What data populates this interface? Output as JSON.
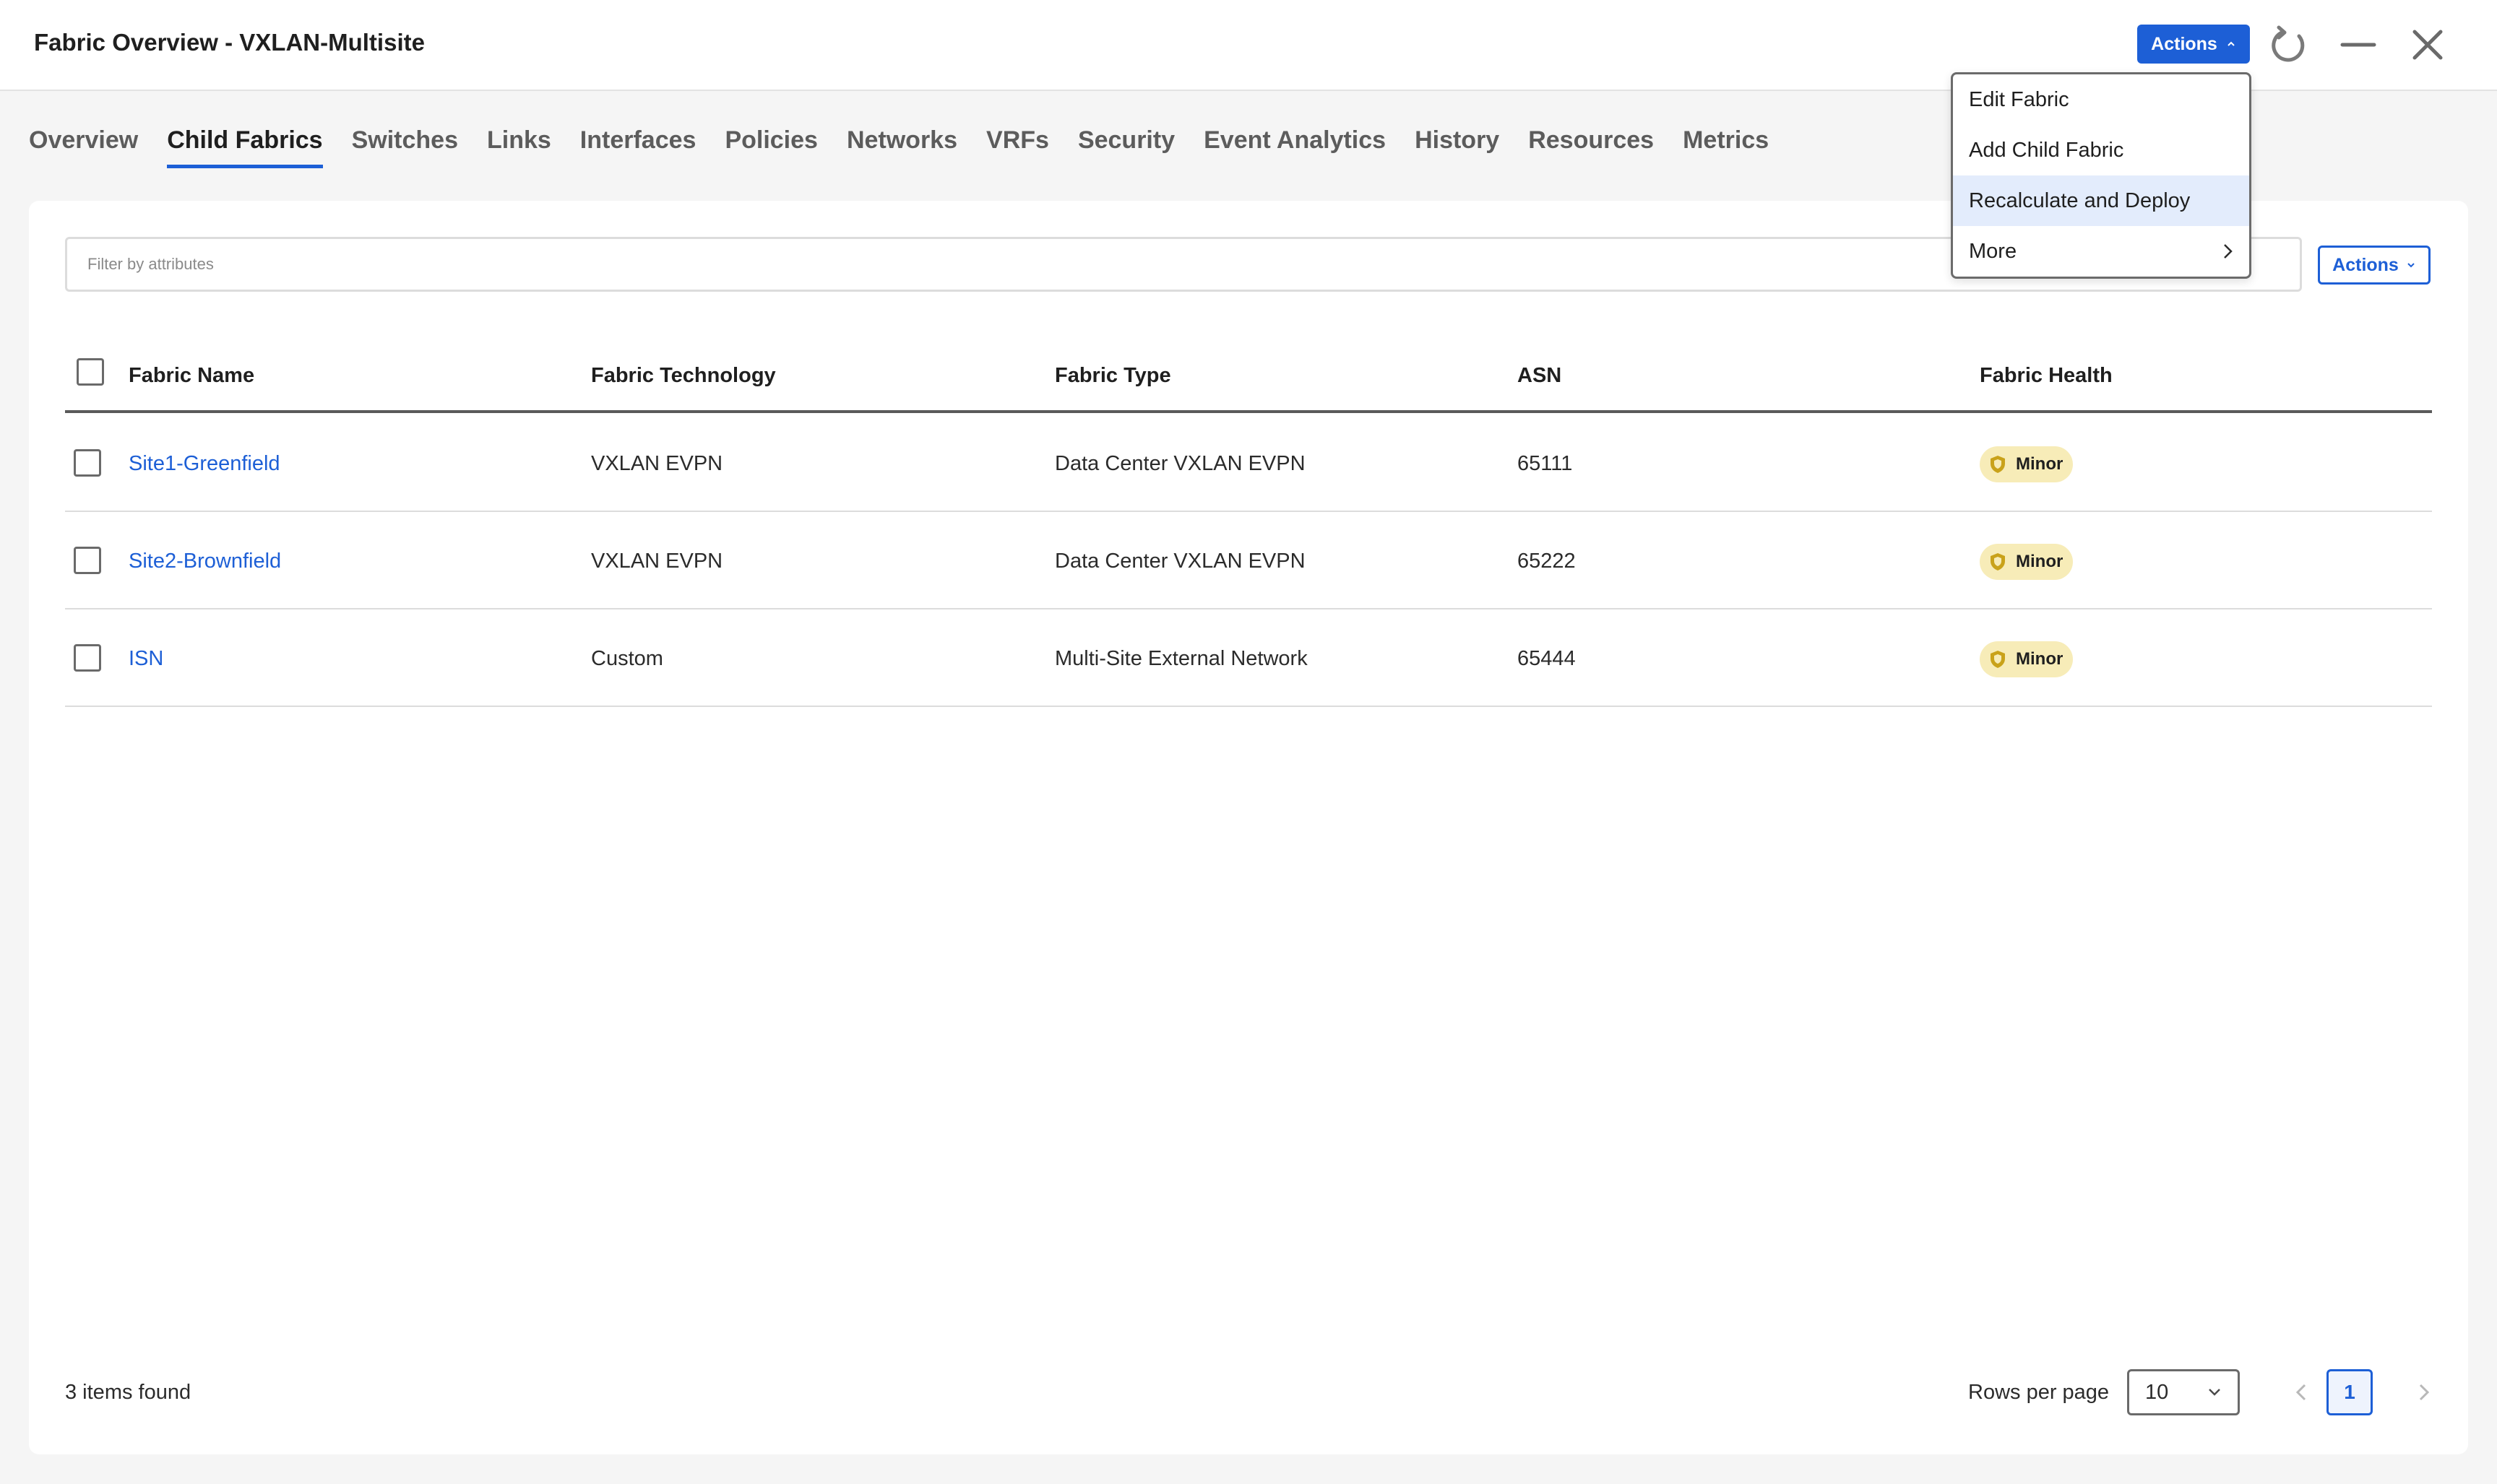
{
  "header": {
    "title": "Fabric Overview - VXLAN-Multisite",
    "actions_label": "Actions"
  },
  "tabs": [
    {
      "label": "Overview"
    },
    {
      "label": "Child Fabrics",
      "active": true
    },
    {
      "label": "Switches"
    },
    {
      "label": "Links"
    },
    {
      "label": "Interfaces"
    },
    {
      "label": "Policies"
    },
    {
      "label": "Networks"
    },
    {
      "label": "VRFs"
    },
    {
      "label": "Security"
    },
    {
      "label": "Event Analytics"
    },
    {
      "label": "History"
    },
    {
      "label": "Resources"
    },
    {
      "label": "Metrics"
    }
  ],
  "filter": {
    "placeholder": "Filter by attributes"
  },
  "table_actions_label": "Actions",
  "table": {
    "columns": [
      "Fabric Name",
      "Fabric Technology",
      "Fabric Type",
      "ASN",
      "Fabric Health"
    ],
    "rows": [
      {
        "name": "Site1-Greenfield",
        "technology": "VXLAN EVPN",
        "type": "Data Center VXLAN EVPN",
        "asn": "65111",
        "health": "Minor"
      },
      {
        "name": "Site2-Brownfield",
        "technology": "VXLAN EVPN",
        "type": "Data Center VXLAN EVPN",
        "asn": "65222",
        "health": "Minor"
      },
      {
        "name": "ISN",
        "technology": "Custom",
        "type": "Multi-Site External Network",
        "asn": "65444",
        "health": "Minor"
      }
    ]
  },
  "footer": {
    "items_found": "3 items found",
    "rows_per_page_label": "Rows per page",
    "rows_per_page": "10",
    "current_page": "1"
  },
  "menu": {
    "items": [
      {
        "label": "Edit Fabric"
      },
      {
        "label": "Add Child Fabric"
      },
      {
        "label": "Recalculate and Deploy",
        "highlighted": true
      },
      {
        "label": "More",
        "submenu": true
      }
    ]
  },
  "colors": {
    "accent": "#1d5fd6",
    "badge_minor": "#f7ecb8",
    "menu_highlight": "#e3ecfc"
  }
}
